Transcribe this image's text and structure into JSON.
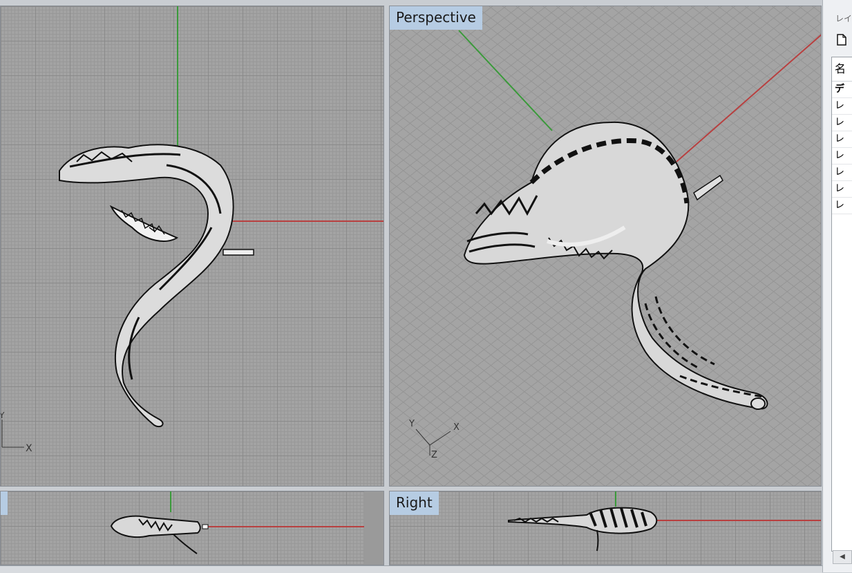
{
  "viewports": {
    "top": {
      "label": "",
      "axis_x": "X",
      "axis_y": "Y"
    },
    "perspective": {
      "label": "Perspective",
      "axis_x": "X",
      "axis_y": "Y",
      "axis_z": "Z"
    },
    "front": {
      "label": ""
    },
    "right": {
      "label": "Right"
    }
  },
  "layers_panel": {
    "title": "レイヤ",
    "header": "名",
    "rows": [
      "デ",
      "レ",
      "レ",
      "レ",
      "レ",
      "レ",
      "レ",
      "レ"
    ]
  },
  "colors": {
    "x_axis": "#b84040",
    "y_axis": "#3a9a3a",
    "viewport_label_bg": "#b6cce3",
    "grid_bg": "#a3a3a3"
  },
  "icons": {
    "new_layer": "new-document-icon",
    "scroll_left": "chevron-left-icon"
  }
}
